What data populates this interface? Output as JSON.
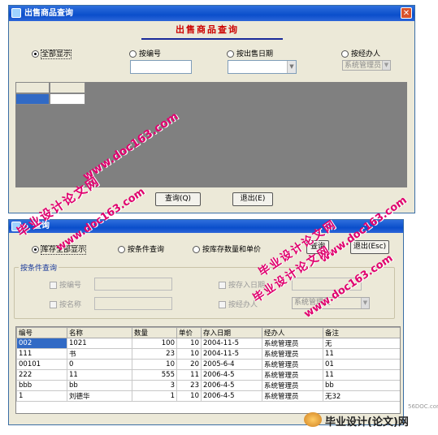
{
  "win1": {
    "title": "出售商品查询",
    "heading": "出售商品查询",
    "close": "✕",
    "radios": [
      "全部显示",
      "按编号",
      "按出售日期",
      "按经办人"
    ],
    "operator_value": "系统管理员",
    "query_btn": "查询(Q)",
    "exit_btn": "退出(E)"
  },
  "win2": {
    "title": "查询",
    "radios": [
      "库存全部显示",
      "按条件查询",
      "按库存数量和单价"
    ],
    "query_btn": "查询",
    "exit_btn": "退出(Esc)",
    "group_title": "按条件查询",
    "checks": [
      "按编号",
      "按名称",
      "按存入日期",
      "按经办人"
    ],
    "operator_value": "系统管理员",
    "columns": [
      "编号",
      "名称",
      "数量",
      "单价",
      "存入日期",
      "经办人",
      "备注"
    ],
    "rows": [
      [
        "002",
        "1021",
        "100",
        "10",
        "2004-11-5",
        "系统管理员",
        "无"
      ],
      [
        "111",
        "书",
        "23",
        "10",
        "2004-11-5",
        "系统管理员",
        "11"
      ],
      [
        "00101",
        "0",
        "10",
        "20",
        "2005-6-4",
        "系统管理员",
        "01"
      ],
      [
        "222",
        "11",
        "555",
        "11",
        "2006-4-5",
        "系统管理员",
        "11"
      ],
      [
        "bbb",
        "bb",
        "3",
        "23",
        "2006-4-5",
        "系统管理员",
        "bb"
      ],
      [
        "1",
        "刘德华",
        "1",
        "10",
        "2006-4-5",
        "系统管理员",
        "无32"
      ]
    ]
  },
  "watermarks": {
    "wm1": "www.doc163.com",
    "wm2": "毕业设计论文网",
    "wm3": "www.doc163.com",
    "wm4": "毕业设计论文网",
    "wm5": "www.doc163.com",
    "wm6": "毕业设计论文网",
    "wm7": "www.doc163.com"
  },
  "footer_logo": {
    "site": "56DOC.com",
    "text": "毕业设计(论文)网"
  },
  "colors": {
    "title_red": "#cc0000",
    "watermark": "#e0006e",
    "selected_cell": "#316ac5"
  }
}
